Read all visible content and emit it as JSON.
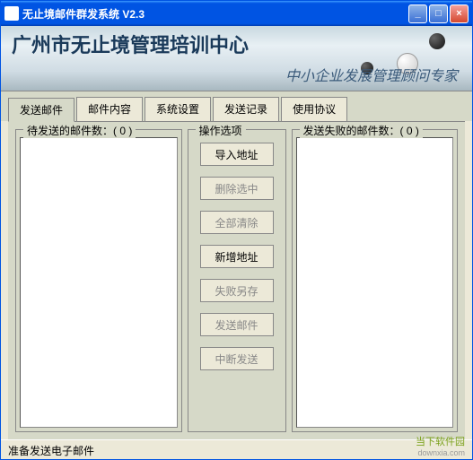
{
  "window": {
    "title": "无止境邮件群发系统   V2.3"
  },
  "banner": {
    "title": "广州市无止境管理培训中心",
    "subtitle": "中小企业发展管理顾问专家"
  },
  "tabs": [
    "发送邮件",
    "邮件内容",
    "系统设置",
    "发送记录",
    "使用协议"
  ],
  "pending": {
    "label": "待发送的邮件数：( 0 )"
  },
  "ops": {
    "label": "操作选项",
    "import": "导入地址",
    "deleteSel": "删除选中",
    "clearAll": "全部清除",
    "addNew": "新增地址",
    "saveFailed": "失败另存",
    "send": "发送邮件",
    "stop": "中断发送"
  },
  "failed": {
    "label": "发送失败的邮件数：( 0 )"
  },
  "status": "准备发送电子邮件",
  "watermark": {
    "main": "当下软件园",
    "sub": "downxia.com"
  }
}
